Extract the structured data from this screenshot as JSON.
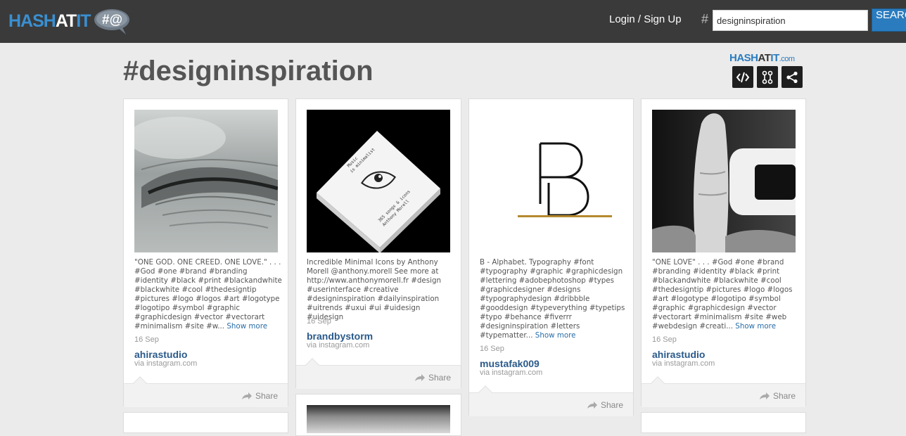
{
  "header": {
    "logo_parts": [
      "HASH",
      "AT",
      "IT"
    ],
    "logo_bubble": "#@",
    "login_label": "Login / Sign Up",
    "hash_symbol": "#",
    "search_value": "designinspiration",
    "search_button": "SEARCH"
  },
  "page": {
    "title": "#designinspiration",
    "brand_parts": [
      "HASH",
      "AT",
      "IT",
      ".com"
    ],
    "tools": [
      "embed-icon",
      "customize-icon",
      "share-icon"
    ]
  },
  "posts": [
    {
      "caption": "\"ONE GOD. ONE CREED. ONE LOVE.\" . . . #God #one #brand #branding #identity #black #print #blackandwhite #blackwhite #cool #thedesigntip #pictures #logo #logos #art #logotype #logotipo #symbol #graphic #graphicdesign #vector #vectorart #minimalism #site #w...",
      "more": "Show more",
      "date": "16 Sep",
      "author": "ahirastudio",
      "via": "via instagram.com",
      "share": "Share"
    },
    {
      "caption": "Incredible Minimal Icons by Anthony Morell @anthony.morell See more at http://www.anthonymorell.fr #design #userinterface #creative #designinspiration #dailyinspiration #uitrends #uxui #ui #uidesign #uidesign",
      "more": "",
      "date": "16 Sep",
      "author": "brandbystorm",
      "via": "via instagram.com",
      "share": "Share",
      "book_lines": [
        "Music",
        "is minimalist",
        "365 songs & icons",
        "Anthony Morell"
      ]
    },
    {
      "caption": "B - Alphabet. Typography #font #typography #graphic #graphicdesign #lettering #adobephotoshop #types #graphicdesigner #designs #typographydesign #dribbble #gooddesign #typeverything #typetips #typo #behance #fiverrr #designinspiration #letters #typematter...",
      "more": "Show more",
      "date": "16 Sep",
      "author": "mustafak009",
      "via": "via instagram.com",
      "share": "Share"
    },
    {
      "caption": "\"ONE LOVE\" . . . #God #one #brand #branding #identity #black #print #blackandwhite #blackwhite #cool #thedesigntip #pictures #logo #logos #art #logotype #logotipo #symbol #graphic #graphicdesign #vector #vectorart #minimalism #site #web #webdesign #creati...",
      "more": "Show more",
      "date": "16 Sep",
      "author": "ahirastudio",
      "via": "via instagram.com",
      "share": "Share"
    }
  ],
  "colors": {
    "topbar": "#3a3a3a",
    "accent": "#2a7cbf",
    "author": "#2a5a8a",
    "background": "#ebebeb"
  }
}
